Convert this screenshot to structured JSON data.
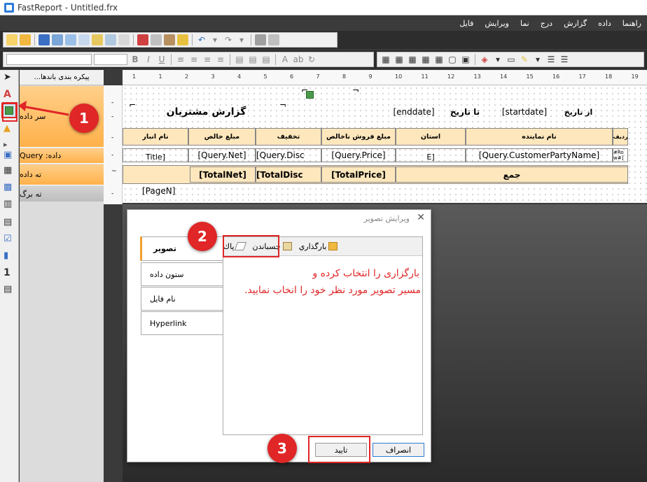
{
  "window": {
    "title": "FastReport - Untitled.frx"
  },
  "menu": [
    "راهنما",
    "داده",
    "گزارش",
    "درج",
    "نما",
    "ويرايش",
    "فايل"
  ],
  "band_panel": {
    "header": "...پيكره بندی باندها",
    "bands": [
      {
        "label": "سر داده"
      },
      {
        "label": "داده: Query"
      },
      {
        "label": "ته داده"
      },
      {
        "label": "ته برگ"
      }
    ]
  },
  "ruler_ticks": [
    "1",
    "1",
    "2",
    "3",
    "4",
    "5",
    "6",
    "7",
    "8",
    "9",
    "10",
    "11",
    "12",
    "13",
    "14",
    "15",
    "16",
    "17",
    "18",
    "19"
  ],
  "report": {
    "title": "گزارش مشتريان",
    "enddate": "[enddate]",
    "to_date_label": "تا تاریخ",
    "startdate": "[startdate]",
    "from_date_label": "از تاریخ",
    "header_cells": [
      "نام انبار",
      "مبلغ خالص",
      "تخفيف",
      "مبلغ فروش ناخالص",
      "استان",
      "نام نماينده",
      "رديف"
    ],
    "data_cells": [
      "Title]",
      "[Query.Net]",
      "[Query.Disc",
      "[Query.Price]",
      "E]",
      "[Query.CustomerPartyName]",
      "#Ro w#]"
    ],
    "total_cells": [
      "[TotalNet]",
      "[TotalDisc",
      "[TotalPrice]",
      "جمع"
    ],
    "page_number": "[PageN]"
  },
  "dialog": {
    "title": "ویرایش تصویر",
    "tabs": [
      "تصوير",
      "ستون داده",
      "نام فایل",
      "Hyperlink"
    ],
    "toolbar": {
      "load": "بارگذاري",
      "paste": "چسباندن",
      "clear": "پاك"
    },
    "instruction_line1": "بارگزاری را انتخاب کرده و",
    "instruction_line2": "مسیر تصویر مورد نظر خود را انخاب نمایید.",
    "ok": "تاييد",
    "cancel": "انصراف"
  },
  "annotations": [
    "1",
    "2",
    "3"
  ],
  "colors": {
    "accent_red": "#e02626",
    "band_orange": "#ffb14a",
    "header_fill": "#ffe7bd"
  }
}
